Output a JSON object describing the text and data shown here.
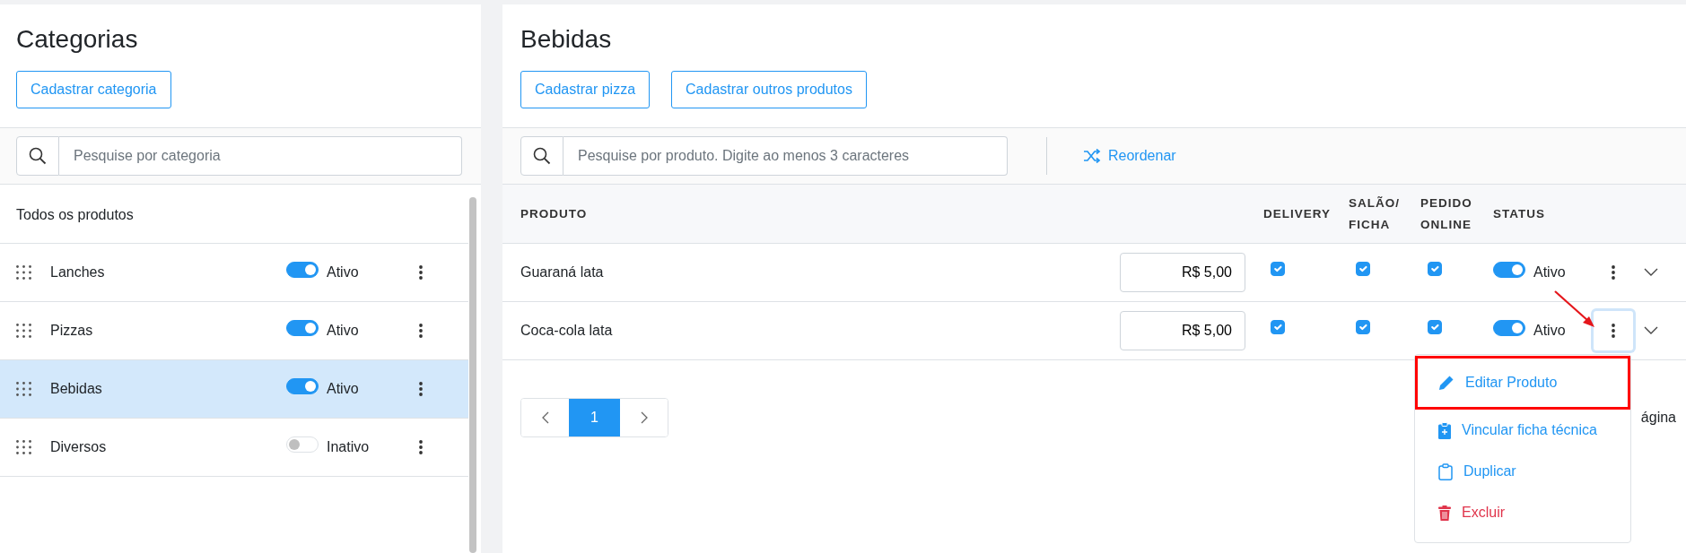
{
  "categories_panel": {
    "title": "Categorias",
    "add_button": "Cadastrar categoria",
    "search": {
      "placeholder": "Pesquise por categoria"
    },
    "all_item": {
      "label": "Todos os produtos",
      "selected": false
    },
    "items": [
      {
        "name": "Lanches",
        "active": true,
        "status": "Ativo",
        "selected": false
      },
      {
        "name": "Pizzas",
        "active": true,
        "status": "Ativo",
        "selected": false
      },
      {
        "name": "Bebidas",
        "active": true,
        "status": "Ativo",
        "selected": true
      },
      {
        "name": "Diversos",
        "active": false,
        "status": "Inativo",
        "selected": false
      }
    ]
  },
  "products_panel": {
    "title": "Bebidas",
    "buttons": [
      "Cadastrar pizza",
      "Cadastrar outros produtos"
    ],
    "search": {
      "placeholder": "Pesquise por produto. Digite ao menos 3 caracteres"
    },
    "reorder_button": "Reordenar",
    "table": {
      "columns": [
        "PRODUTO",
        "DELIVERY",
        "SALÃO/ FICHA",
        "PEDIDO ONLINE",
        "STATUS"
      ],
      "rows": [
        {
          "name": "Guaraná lata",
          "price": "R$ 5,00",
          "delivery": true,
          "salon": true,
          "online": true,
          "active": true,
          "status": "Ativo",
          "menu_open": false
        },
        {
          "name": "Coca-cola lata",
          "price": "R$ 5,00",
          "delivery": true,
          "salon": true,
          "online": true,
          "active": true,
          "status": "Ativo",
          "menu_open": true
        }
      ]
    }
  },
  "row_menu": {
    "items": [
      {
        "kind": "edit",
        "label": "Editar Produto",
        "highlighted": true
      },
      {
        "kind": "link",
        "label": "Vincular ficha técnica",
        "highlighted": false
      },
      {
        "kind": "duplicate",
        "label": "Duplicar",
        "highlighted": false
      },
      {
        "kind": "delete",
        "label": "Excluir",
        "highlighted": false
      }
    ]
  },
  "pagination": {
    "pages": [
      {
        "label": "1",
        "selected": true
      }
    ]
  },
  "page_size_label": "ágina"
}
